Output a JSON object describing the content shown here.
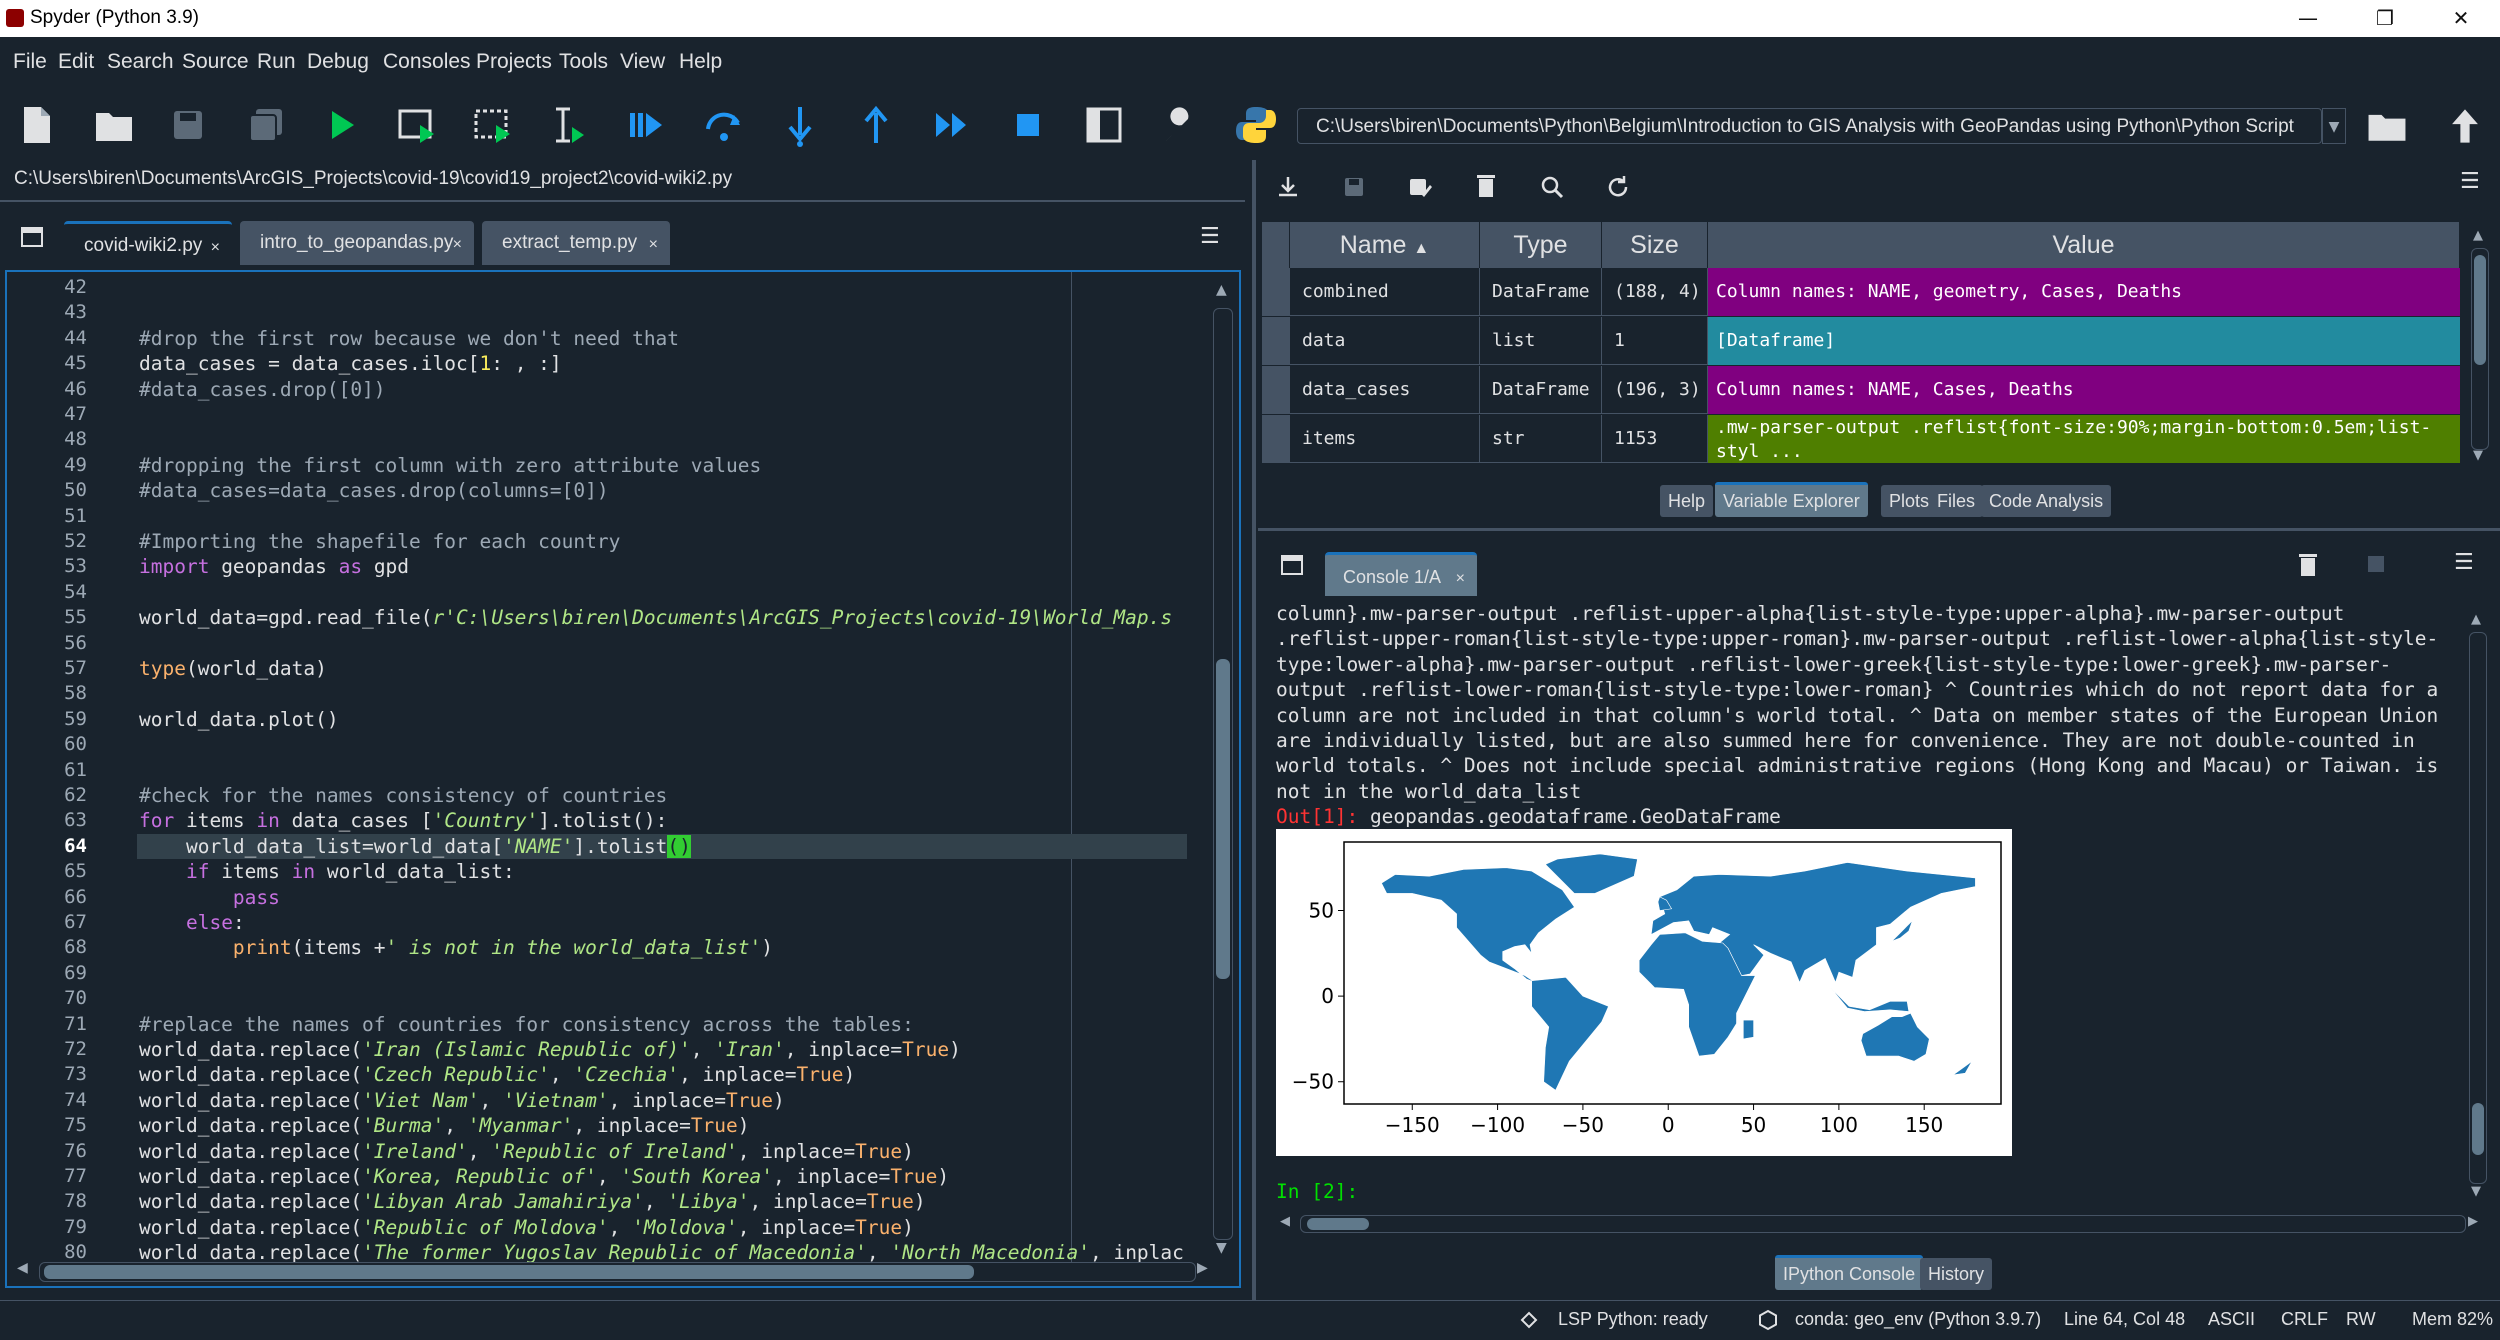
{
  "window": {
    "title": "Spyder (Python 3.9)"
  },
  "menu": [
    "File",
    "Edit",
    "Search",
    "Source",
    "Run",
    "Debug",
    "Consoles",
    "Projects",
    "Tools",
    "View",
    "Help"
  ],
  "toolbar": {
    "working_dir": "C:\\Users\\biren\\Documents\\Python\\Belgium\\Introduction to GIS Analysis with GeoPandas using Python\\Python Script"
  },
  "editor": {
    "file_path": "C:\\Users\\biren\\Documents\\ArcGIS_Projects\\covid-19\\covid19_project2\\covid-wiki2.py",
    "tabs": [
      {
        "label": "covid-wiki2.py",
        "close": "×"
      },
      {
        "label": "intro_to_geopandas.py",
        "close": "×"
      },
      {
        "label": "extract_temp.py",
        "close": "×"
      }
    ],
    "line_numbers": [
      "42",
      "43",
      "44",
      "45",
      "46",
      "47",
      "48",
      "49",
      "50",
      "51",
      "52",
      "53",
      "54",
      "55",
      "56",
      "57",
      "58",
      "59",
      "60",
      "61",
      "62",
      "63",
      "64",
      "65",
      "66",
      "67",
      "68",
      "69",
      "70",
      "71",
      "72",
      "73",
      "74",
      "75",
      "76",
      "77",
      "78",
      "79",
      "80"
    ],
    "current_line": "64"
  },
  "variable_explorer": {
    "columns": [
      "Name",
      "Type",
      "Size",
      "Value"
    ],
    "rows": [
      {
        "name": "combined",
        "type": "DataFrame",
        "size": "(188, 4)",
        "value": "Column names: NAME, geometry, Cases, Deaths",
        "color": "#800080"
      },
      {
        "name": "data",
        "type": "list",
        "size": "1",
        "value": "[Dataframe]",
        "color": "#228b9f"
      },
      {
        "name": "data_cases",
        "type": "DataFrame",
        "size": "(196, 3)",
        "value": "Column names: NAME, Cases, Deaths",
        "color": "#800080"
      },
      {
        "name": "items",
        "type": "str",
        "size": "1153",
        "value": ".mw-parser-output .reflist{font-size:90%;margin-bottom:0.5em;list-styl ...",
        "color": "#4f7f00"
      }
    ]
  },
  "pane_tabs_top": [
    "Help",
    "Variable Explorer",
    "Plots",
    "Files",
    "Code Analysis"
  ],
  "console": {
    "tab_label": "Console 1/A",
    "tab_close": "×",
    "lines": [
      "column}.mw-parser-output .reflist-upper-alpha{list-style-type:upper-alpha}.mw-parser-output",
      ".reflist-upper-roman{list-style-type:upper-roman}.mw-parser-output .reflist-lower-alpha{list-style-",
      "type:lower-alpha}.mw-parser-output .reflist-lower-greek{list-style-type:lower-greek}.mw-parser-",
      "output .reflist-lower-roman{list-style-type:lower-roman} ^ Countries which do not report data for a",
      "column are not included in that column's world total. ^ Data on member states of the European Union",
      "are individually listed, but are also summed here for convenience. They are not double-counted in",
      "world totals. ^ Does not include special administrative regions (Hong Kong and Macau) or Taiwan. is",
      "not in the world_data_list"
    ],
    "out_prompt": "Out[1]:",
    "out_value": "geopandas.geodataframe.GeoDataFrame",
    "in_prompt": "In [2]:"
  },
  "chart_data": {
    "type": "scatter",
    "title": "",
    "xlabel": "",
    "ylabel": "",
    "xlim": [
      -190,
      195
    ],
    "ylim": [
      -63,
      90
    ],
    "xticks": [
      "−150",
      "−100",
      "−50",
      "0",
      "50",
      "100",
      "150"
    ],
    "yticks": [
      "50",
      "0",
      "−50"
    ],
    "fill_color": "#1f77b4",
    "series": []
  },
  "pane_tabs_bottom": [
    "IPython Console",
    "History"
  ],
  "statusbar": {
    "lsp": "LSP Python: ready",
    "env": "conda: geo_env (Python 3.9.7)",
    "cursor": "Line 64, Col 48",
    "encoding": "ASCII",
    "eol": "CRLF",
    "rw": "RW",
    "mem": "Mem 82%"
  }
}
